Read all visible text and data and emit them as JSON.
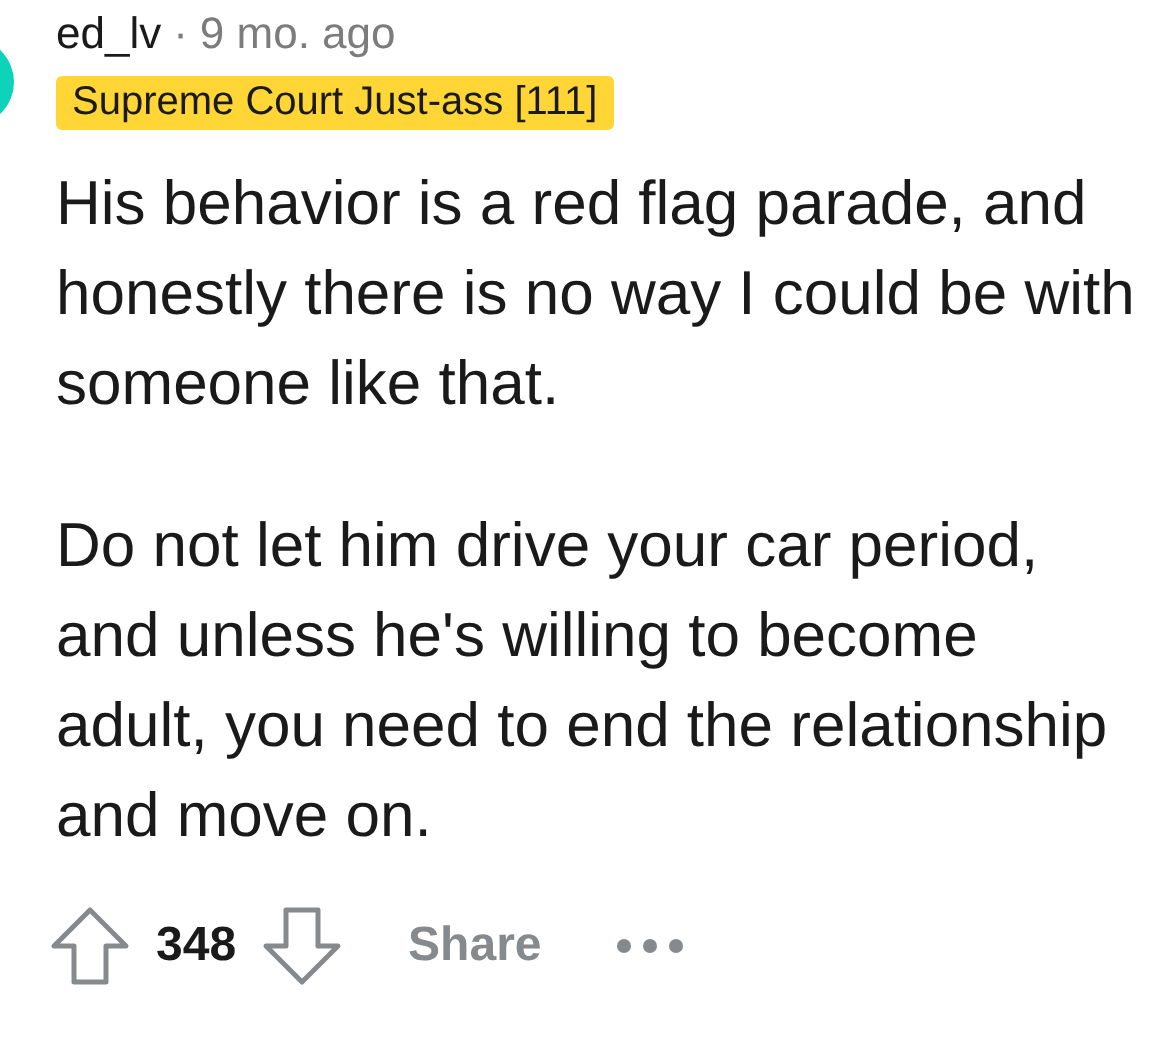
{
  "comment": {
    "author": "ed_lv",
    "separator": "·",
    "time": "9 mo. ago",
    "flair": "Supreme Court Just-ass [111]",
    "paragraphs": [
      "His behavior is a red flag parade, and honestly there is no way I could be with someone like that.",
      "Do not let him drive your car period, and unless he's willing to become adult, you need to end the relationship and move on."
    ],
    "score": "348",
    "share": "Share"
  }
}
